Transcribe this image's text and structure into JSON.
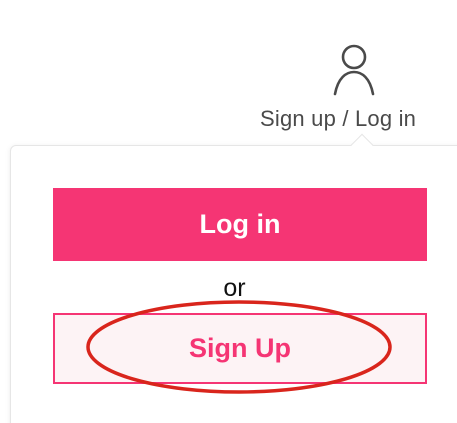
{
  "header": {
    "account_label": "Sign up / Log in",
    "icon": "user-icon"
  },
  "dropdown": {
    "login_label": "Log in",
    "or_label": "or",
    "signup_label": "Sign Up"
  },
  "colors": {
    "accent": "#f53574",
    "signup_bg": "#fdf3f5",
    "annotation": "#d9251c"
  }
}
